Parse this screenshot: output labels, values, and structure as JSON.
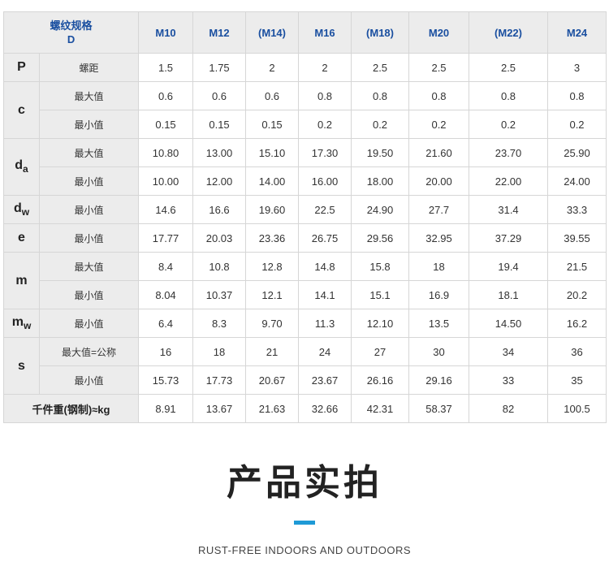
{
  "table": {
    "header_label_line1": "螺纹规格",
    "header_label_line2": "D",
    "columns": [
      "M10",
      "M12",
      "(M14)",
      "M16",
      "(M18)",
      "M20",
      "(M22)",
      "M24"
    ],
    "rows": [
      {
        "symbol": "P",
        "sub": "",
        "label": "螺距",
        "values": [
          "1.5",
          "1.75",
          "2",
          "2",
          "2.5",
          "2.5",
          "2.5",
          "3"
        ]
      },
      {
        "symbol": "c",
        "sub": "",
        "label": "最大值",
        "values": [
          "0.6",
          "0.6",
          "0.6",
          "0.8",
          "0.8",
          "0.8",
          "0.8",
          "0.8"
        ]
      },
      {
        "symbol": "",
        "sub": "",
        "label": "最小值",
        "values": [
          "0.15",
          "0.15",
          "0.15",
          "0.2",
          "0.2",
          "0.2",
          "0.2",
          "0.2"
        ]
      },
      {
        "symbol": "d",
        "sub": "a",
        "label": "最大值",
        "values": [
          "10.80",
          "13.00",
          "15.10",
          "17.30",
          "19.50",
          "21.60",
          "23.70",
          "25.90"
        ]
      },
      {
        "symbol": "",
        "sub": "",
        "label": "最小值",
        "values": [
          "10.00",
          "12.00",
          "14.00",
          "16.00",
          "18.00",
          "20.00",
          "22.00",
          "24.00"
        ]
      },
      {
        "symbol": "d",
        "sub": "w",
        "label": "最小值",
        "values": [
          "14.6",
          "16.6",
          "19.60",
          "22.5",
          "24.90",
          "27.7",
          "31.4",
          "33.3"
        ]
      },
      {
        "symbol": "e",
        "sub": "",
        "label": "最小值",
        "values": [
          "17.77",
          "20.03",
          "23.36",
          "26.75",
          "29.56",
          "32.95",
          "37.29",
          "39.55"
        ]
      },
      {
        "symbol": "m",
        "sub": "",
        "label": "最大值",
        "values": [
          "8.4",
          "10.8",
          "12.8",
          "14.8",
          "15.8",
          "18",
          "19.4",
          "21.5"
        ]
      },
      {
        "symbol": "",
        "sub": "",
        "label": "最小值",
        "values": [
          "8.04",
          "10.37",
          "12.1",
          "14.1",
          "15.1",
          "16.9",
          "18.1",
          "20.2"
        ]
      },
      {
        "symbol": "m",
        "sub": "w",
        "label": "最小值",
        "values": [
          "6.4",
          "8.3",
          "9.70",
          "11.3",
          "12.10",
          "13.5",
          "14.50",
          "16.2"
        ]
      },
      {
        "symbol": "s",
        "sub": "",
        "label": "最大值=公称",
        "values": [
          "16",
          "18",
          "21",
          "24",
          "27",
          "30",
          "34",
          "36"
        ]
      },
      {
        "symbol": "",
        "sub": "",
        "label": "最小值",
        "values": [
          "15.73",
          "17.73",
          "20.67",
          "23.67",
          "26.16",
          "29.16",
          "33",
          "35"
        ]
      }
    ],
    "weight_label": "千件重(钢制)≈kg",
    "weight_values": [
      "8.91",
      "13.67",
      "21.63",
      "32.66",
      "42.31",
      "58.37",
      "82",
      "100.5"
    ]
  },
  "section_title": "产品实拍",
  "section_subtitle": "RUST-FREE INDOORS AND OUTDOORS",
  "colors": {
    "header_text": "#1a4fa0",
    "accent": "#1e9ad6",
    "label_bg": "#ececec"
  }
}
